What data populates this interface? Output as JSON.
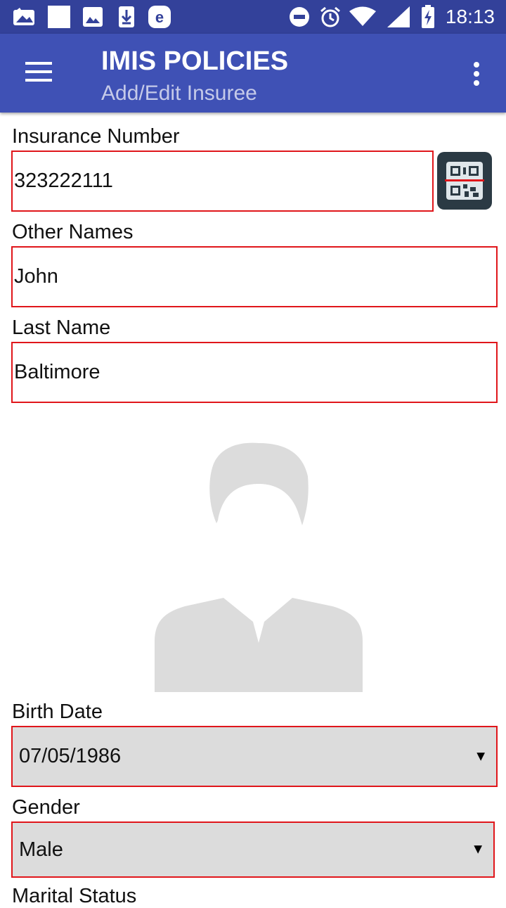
{
  "status_bar": {
    "time": "18:13",
    "icons": [
      "gallery-icon",
      "blank-notification-icon",
      "image-icon",
      "download-icon",
      "e-app-icon",
      "do-not-disturb-icon",
      "alarm-icon",
      "wifi-icon",
      "signal-icon",
      "battery-charging-icon"
    ]
  },
  "app_bar": {
    "title": "IMIS POLICIES",
    "subtitle": "Add/Edit Insuree",
    "menu_icon": "hamburger-menu-icon",
    "overflow_icon": "more-vert-icon"
  },
  "form": {
    "insurance_number": {
      "label": "Insurance Number",
      "value": "323222111"
    },
    "qr_scan_icon": "qr-scan-icon",
    "other_names": {
      "label": "Other Names",
      "value": "John"
    },
    "last_name": {
      "label": "Last Name",
      "value": "Baltimore"
    },
    "photo_icon": "person-placeholder-icon",
    "birth_date": {
      "label": "Birth Date",
      "value": "07/05/1986"
    },
    "gender": {
      "label": "Gender",
      "value": "Male"
    },
    "marital_status": {
      "label": "Marital Status"
    }
  },
  "colors": {
    "status_bar": "#33419a",
    "app_bar": "#3f51b5",
    "subtitle": "#c5cae9",
    "field_border": "#e0161b",
    "select_background": "#dcdcdc",
    "placeholder_gray": "#dcdcdc"
  }
}
